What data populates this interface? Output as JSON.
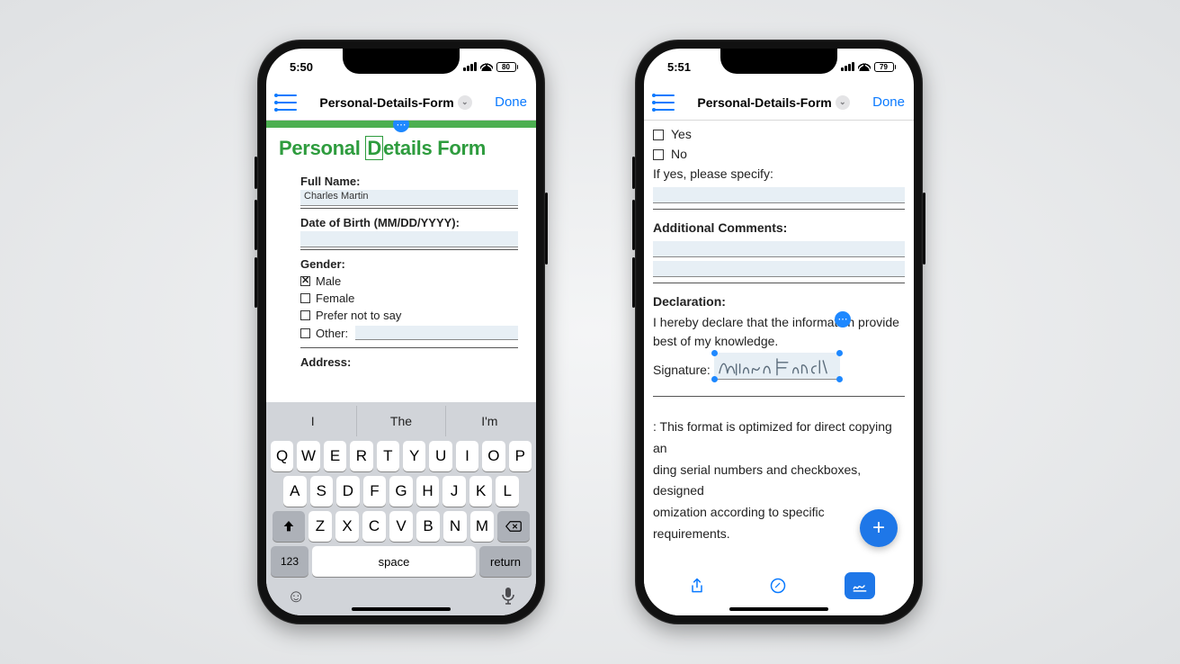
{
  "phone1": {
    "status": {
      "time": "5:50",
      "battery": "80"
    },
    "nav": {
      "title": "Personal-Details-Form",
      "done": "Done"
    },
    "form": {
      "title_a": "Personal ",
      "title_b": "etails Form",
      "full_name_label": "Full Name:",
      "full_name_value": "Charles Martin",
      "dob_label": "Date of Birth (MM/DD/YYYY):",
      "gender_label": "Gender:",
      "gender_options": {
        "male": "Male",
        "female": "Female",
        "prefer": "Prefer not to say",
        "other": "Other:"
      },
      "address_label": "Address:"
    },
    "keyboard": {
      "predictions": [
        "I",
        "The",
        "I'm"
      ],
      "row1": [
        "Q",
        "W",
        "E",
        "R",
        "T",
        "Y",
        "U",
        "I",
        "O",
        "P"
      ],
      "row2": [
        "A",
        "S",
        "D",
        "F",
        "G",
        "H",
        "J",
        "K",
        "L"
      ],
      "row3": [
        "Z",
        "X",
        "C",
        "V",
        "B",
        "N",
        "M"
      ],
      "k123": "123",
      "space": "space",
      "ret": "return"
    }
  },
  "phone2": {
    "status": {
      "time": "5:51",
      "battery": "79"
    },
    "nav": {
      "title": "Personal-Details-Form",
      "done": "Done"
    },
    "body": {
      "yes": "Yes",
      "no": "No",
      "specify": "If yes, please specify:",
      "comments_label": "Additional Comments:",
      "declaration_label": "Declaration:",
      "declaration_text_a": "I hereby declare that the information",
      "declaration_text_b": "provide",
      "declaration_text_c": "best of my knowledge.",
      "signature_label": "Signature:",
      "note1": ": This format is optimized for direct copying an",
      "note2": "ding serial numbers and checkboxes, designed",
      "note3": "omization according to specific requirements."
    }
  }
}
